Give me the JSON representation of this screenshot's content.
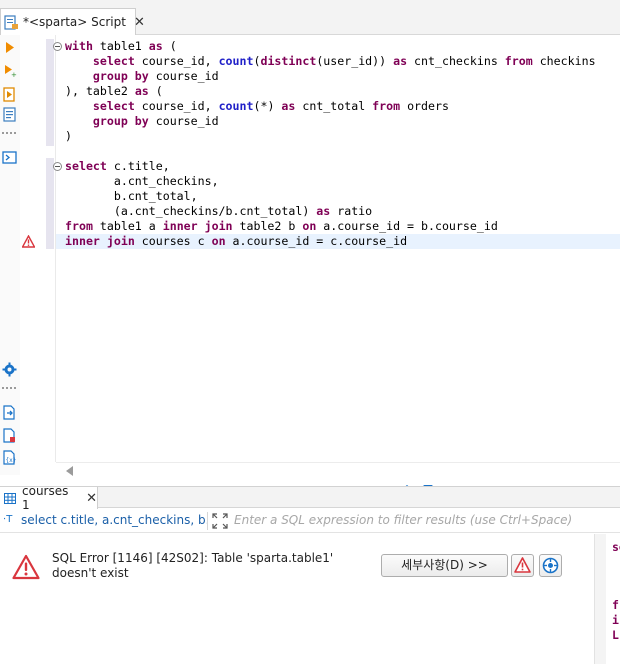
{
  "editor_tab": {
    "title": "*<sparta> Script",
    "close": "✕"
  },
  "editor": {
    "lines": [
      [
        {
          "t": "with ",
          "c": "kw"
        },
        {
          "t": "table1 "
        },
        {
          "t": "as ",
          "c": "kw"
        },
        {
          "t": "("
        }
      ],
      [
        {
          "t": "    "
        },
        {
          "t": "select ",
          "c": "kw"
        },
        {
          "t": "course_id, "
        },
        {
          "t": "count",
          "c": "fn"
        },
        {
          "t": "("
        },
        {
          "t": "distinct",
          "c": "kw"
        },
        {
          "t": "(user_id)) "
        },
        {
          "t": "as ",
          "c": "kw"
        },
        {
          "t": "cnt_checkins "
        },
        {
          "t": "from ",
          "c": "kw"
        },
        {
          "t": "checkins"
        }
      ],
      [
        {
          "t": "    "
        },
        {
          "t": "group by ",
          "c": "kw"
        },
        {
          "t": "course_id"
        }
      ],
      [
        {
          "t": "), table2 "
        },
        {
          "t": "as ",
          "c": "kw"
        },
        {
          "t": "("
        }
      ],
      [
        {
          "t": "    "
        },
        {
          "t": "select ",
          "c": "kw"
        },
        {
          "t": "course_id, "
        },
        {
          "t": "count",
          "c": "fn"
        },
        {
          "t": "(*) "
        },
        {
          "t": "as ",
          "c": "kw"
        },
        {
          "t": "cnt_total "
        },
        {
          "t": "from ",
          "c": "kw"
        },
        {
          "t": "orders"
        }
      ],
      [
        {
          "t": "    "
        },
        {
          "t": "group by ",
          "c": "kw"
        },
        {
          "t": "course_id"
        }
      ],
      [
        {
          "t": ")"
        }
      ],
      [],
      [
        {
          "t": "select ",
          "c": "kw"
        },
        {
          "t": "c.title,"
        }
      ],
      [
        {
          "t": "       a.cnt_checkins,"
        }
      ],
      [
        {
          "t": "       b.cnt_total,"
        }
      ],
      [
        {
          "t": "       (a.cnt_checkins/b.cnt_total) "
        },
        {
          "t": "as ",
          "c": "kw"
        },
        {
          "t": "ratio"
        }
      ],
      [
        {
          "t": "from ",
          "c": "kw"
        },
        {
          "t": "table1 a "
        },
        {
          "t": "inner join ",
          "c": "kw"
        },
        {
          "t": "table2 b "
        },
        {
          "t": "on ",
          "c": "kw"
        },
        {
          "t": "a.course_id = b.course_id"
        }
      ],
      [
        {
          "t": "inner join ",
          "c": "kw"
        },
        {
          "t": "courses c "
        },
        {
          "t": "on ",
          "c": "kw"
        },
        {
          "t": "a.course_id = c.course_id"
        }
      ]
    ]
  },
  "result_tab": {
    "title": "courses 1",
    "close": "✕"
  },
  "filter": {
    "icon": "T",
    "query": "select c.title, a.cnt_checkins, b.cnt_total,",
    "placeholder": "Enter a SQL expression to filter results (use Ctrl+Space)"
  },
  "error": {
    "message": "SQL Error [1146] [42S02]: Table 'sparta.table1' doesn't exist",
    "details_button": "세부사항(D) >>"
  },
  "side_panel": {
    "line1": "se",
    "line2": "f",
    "line3": "i",
    "line4": "L"
  },
  "colors": {
    "keyword": "#7f0055",
    "function": "#2020c8",
    "error": "#d9363e",
    "link": "#1a5fa8"
  }
}
